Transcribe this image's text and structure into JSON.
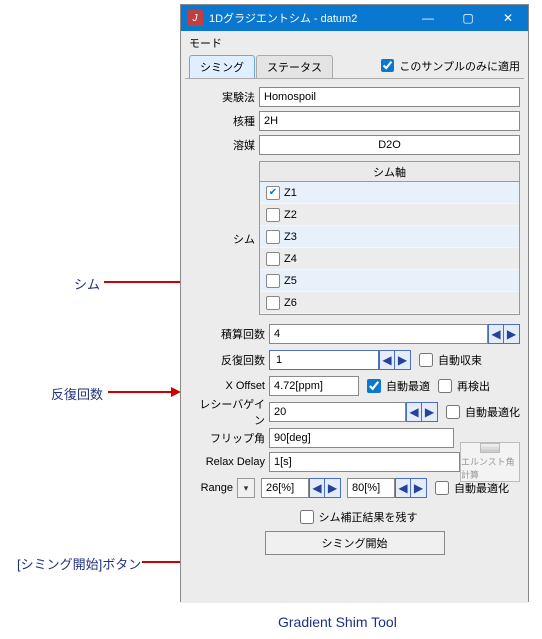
{
  "title": "1Dグラジエントシム - datum2",
  "mode": "モード",
  "tabs": {
    "shim": "シミング",
    "status": "ステータス"
  },
  "apply_this_sample": "このサンプルのみに適用",
  "labels": {
    "method": "実験法",
    "nuclei": "核種",
    "solvent": "溶媒",
    "shim_side": "シム",
    "shim_axis_header": "シム軸",
    "scans": "積算回数",
    "repeat": "反復回数",
    "auto_converge": "自動収束",
    "xoffset": "X Offset",
    "auto_opt": "自動最適",
    "redetect": "再検出",
    "rgain": "レシーバゲイン",
    "auto_optimize": "自動最適化",
    "flip": "フリップ角",
    "relax": "Relax Delay",
    "range": "Range",
    "ernst": "エルンスト角計算",
    "keep_corr": "シム補正結果を残す",
    "start": "シミング開始"
  },
  "values": {
    "method": "Homospoil",
    "nuclei": "2H",
    "solvent": "D2O",
    "scans": "4",
    "repeat": "1",
    "xoffset": "4.72[ppm]",
    "rgain": "20",
    "flip": "90[deg]",
    "relax": "1[s]",
    "range_low": "26[%]",
    "range_high": "80[%]"
  },
  "shim_axes": [
    {
      "label": "Z1",
      "checked": true
    },
    {
      "label": "Z2",
      "checked": false
    },
    {
      "label": "Z3",
      "checked": false
    },
    {
      "label": "Z4",
      "checked": false
    },
    {
      "label": "Z5",
      "checked": false
    },
    {
      "label": "Z6",
      "checked": false
    }
  ],
  "annotations": {
    "shim": "シム",
    "repeat": "反復回数",
    "start": "[シミング開始]ボタン",
    "caption": "Gradient Shim Tool"
  }
}
